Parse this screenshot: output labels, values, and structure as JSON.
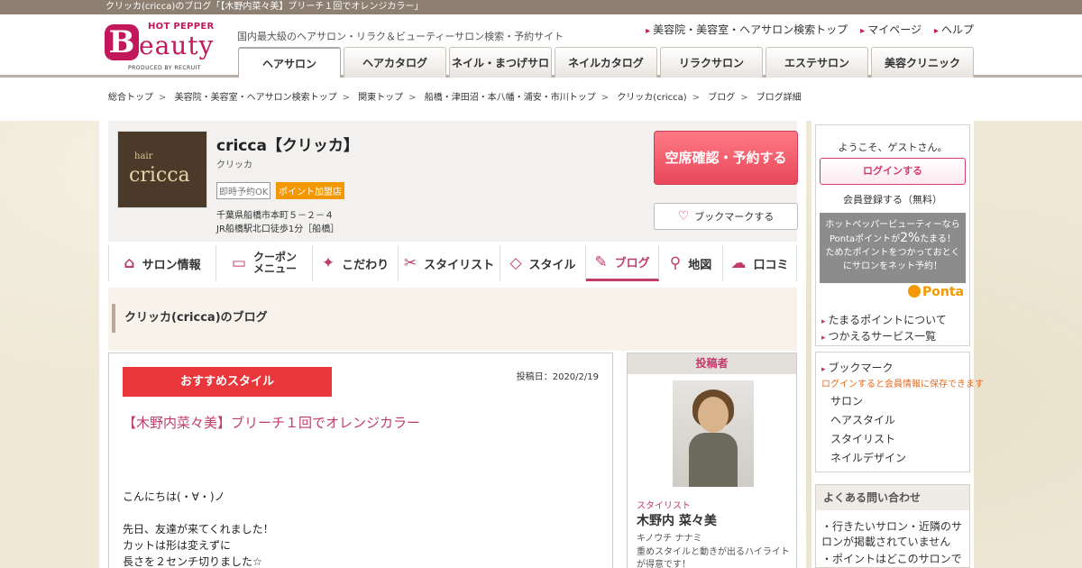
{
  "page": {
    "title": "クリッカ(cricca)のブログ「【木野内菜々美】ブリーチ１回でオレンジカラー」"
  },
  "header": {
    "logo": {
      "hot_pepper": "HOT PEPPER",
      "b": "B",
      "eauty": "eauty",
      "produced": "PRODUCED BY RECRUIT"
    },
    "tagline": "国内最大級のヘアサロン・リラク＆ビューティーサロン検索・予約サイト",
    "links": [
      "美容院・美容室・ヘアサロン検索トップ",
      "マイページ",
      "ヘルプ"
    ],
    "tabs": [
      "ヘアサロン",
      "ヘアカタログ",
      "ネイル・まつげサロン",
      "ネイルカタログ",
      "リラクサロン",
      "エステサロン",
      "美容クリニック"
    ],
    "active_tab": 0
  },
  "breadcrumb": [
    "総合トップ",
    "美容院・美容室・ヘアサロン検索トップ",
    "関東トップ",
    "船橋・津田沼・本八幡・浦安・市川トップ",
    "クリッカ(cricca)",
    "ブログ",
    "ブログ詳細"
  ],
  "salon": {
    "image_text": {
      "hair": "hair",
      "name": "cricca"
    },
    "name": "cricca【クリッカ】",
    "kana": "クリッカ",
    "badge_instant": "即時予約OK",
    "badge_point": "ポイント加盟店",
    "address": "千葉県船橋市本町５－２－４",
    "access": "JR船橋駅北口徒歩1分［船橋］",
    "reserve_label": "空席確認・予約する",
    "bookmark_label": "ブックマークする"
  },
  "salon_nav": [
    {
      "label": "サロン情報",
      "icon": "home-icon"
    },
    {
      "label": "クーポン",
      "label2": "メニュー",
      "icon": "coupon-icon"
    },
    {
      "label": "こだわり",
      "icon": "sparkle-icon"
    },
    {
      "label": "スタイリスト",
      "icon": "scissors-icon"
    },
    {
      "label": "スタイル",
      "icon": "photo-icon"
    },
    {
      "label": "ブログ",
      "icon": "pencil-icon",
      "active": true
    },
    {
      "label": "地図",
      "icon": "map-pin-icon"
    },
    {
      "label": "口コミ",
      "icon": "chat-icon"
    }
  ],
  "blog": {
    "section_title": "クリッカ(cricca)のブログ",
    "category": "おすすめスタイル",
    "post_date": "投稿日：2020/2/19",
    "title": "【木野内菜々美】ブリーチ１回でオレンジカラー",
    "body": [
      "こんにちは(・∀・)ノ",
      "",
      "先日、友達が来てくれました！",
      "カットは形は変えずに",
      "長さを２センチ切りました☆"
    ]
  },
  "poster": {
    "header": "投稿者",
    "role": "スタイリスト",
    "name": "木野内 菜々美",
    "kana": "キノウチ ナナミ",
    "desc": "重めスタイルと動きが出るハイライトが得意です！"
  },
  "sidebar": {
    "welcome": "ようこそ、ゲストさん。",
    "login": "ログインする",
    "register": "会員登録する（無料）",
    "ponta_lines": [
      "ホットペッパービューティーなら",
      "Pontaポイントが",
      "2%",
      "たまる！",
      "ためたポイントをつかっておとく",
      "にサロンをネット予約！"
    ],
    "ponta_logo": "Ponta",
    "point_links": [
      "たまるポイントについて",
      "つかえるサービス一覧"
    ],
    "bookmark_title": "ブックマーク",
    "bookmark_note": "ログインすると会員情報に保存できます",
    "bookmark_items": [
      "サロン",
      "ヘアスタイル",
      "スタイリスト",
      "ネイルデザイン"
    ],
    "faq_title": "よくある問い合わせ",
    "faq_items": [
      "行きたいサロン・近隣のサロンが掲載されていません",
      "ポイントはどこのサロンで使"
    ]
  },
  "colors": {
    "brand": "#c2185b",
    "accent": "#c03c6a",
    "reserve": "#e9465a",
    "recommend": "#e8363a",
    "point": "#f39800"
  }
}
